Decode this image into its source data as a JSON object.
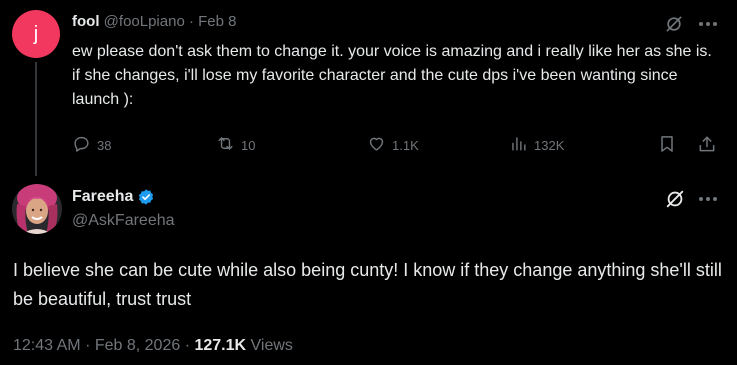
{
  "reply": {
    "avatar_letter": "j",
    "avatar_color": "#f3385f",
    "display_name": "fool",
    "handle": "@fooLpiano",
    "separator": "·",
    "date": "Feb 8",
    "text": "ew please don't ask them to change it. your voice is amazing and i really like her as she is. if she changes, i'll lose my favorite character and the cute dps i've been wanting since launch ):",
    "stats": {
      "replies": "38",
      "reposts": "10",
      "likes": "1.1K",
      "views": "132K"
    }
  },
  "main": {
    "display_name": "Fareeha",
    "verified_color": "#1d9bf0",
    "handle": "@AskFareeha",
    "text": "I believe she can be cute while also being cunty! I know if they change anything she'll still be beautiful, trust trust",
    "time": "12:43 AM",
    "sep1": "·",
    "date": "Feb 8, 2026",
    "sep2": "·",
    "views_count": "127.1K",
    "views_label": "Views"
  },
  "icons": [
    "grok-icon",
    "more-icon",
    "reply-icon",
    "repost-icon",
    "like-icon",
    "views-icon",
    "bookmark-icon",
    "share-icon",
    "verified-badge-icon"
  ]
}
